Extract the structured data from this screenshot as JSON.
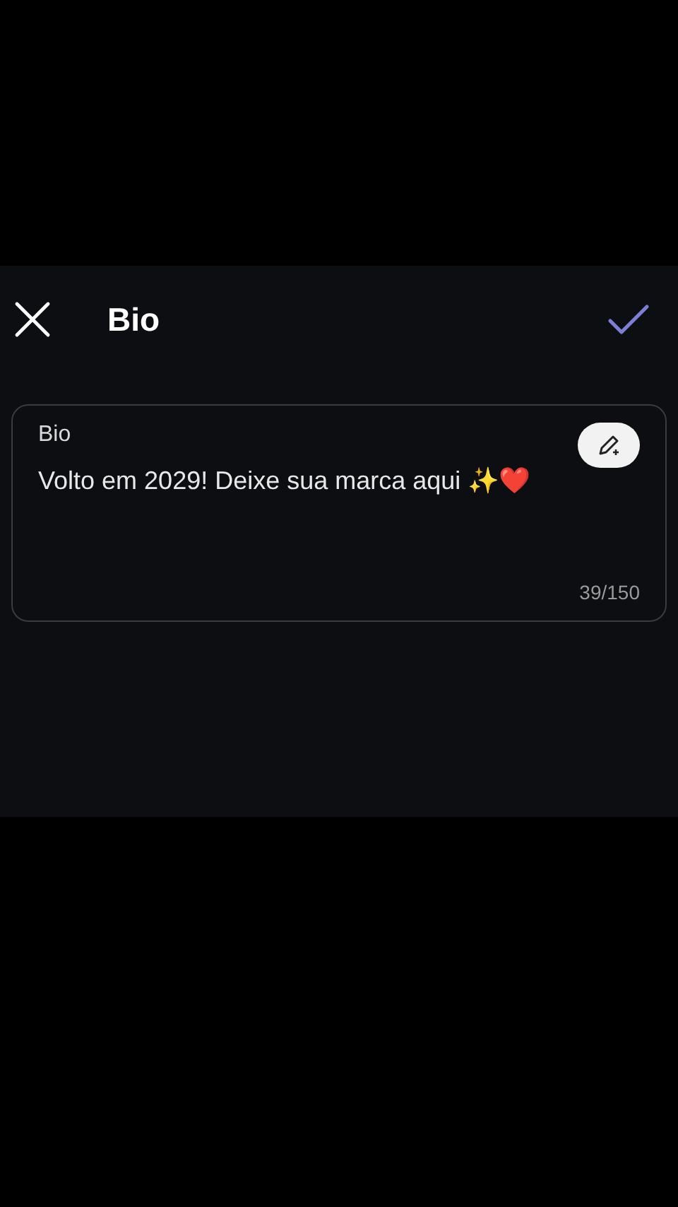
{
  "header": {
    "title": "Bio"
  },
  "bio_field": {
    "label": "Bio",
    "value": "Volto em 2029! Deixe sua marca aqui ✨❤️",
    "counter": "39/150"
  }
}
